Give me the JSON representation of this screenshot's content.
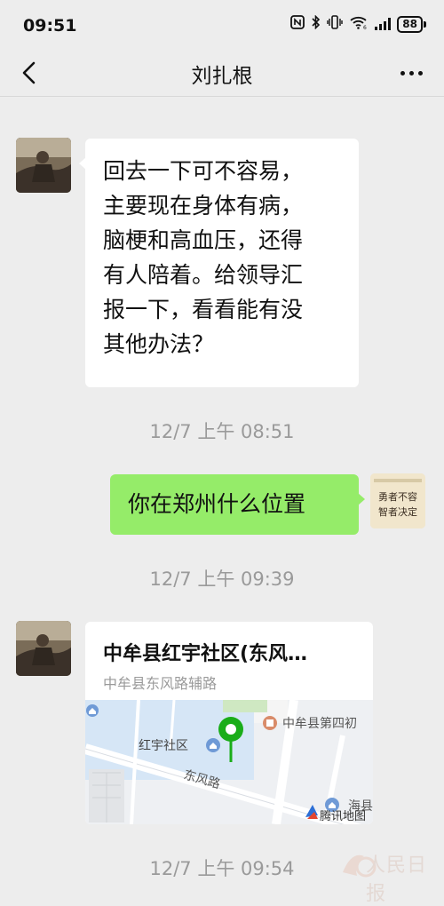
{
  "status_bar": {
    "time": "09:51",
    "battery": "88",
    "icons": [
      "nfc-icon",
      "bluetooth-icon",
      "vibrate-icon",
      "wifi-icon",
      "signal-icon",
      "battery-icon"
    ]
  },
  "nav": {
    "title": "刘扎根",
    "back_icon": "chevron-left-icon",
    "more_icon": "more-dots-icon"
  },
  "messages": [
    {
      "side": "left",
      "type": "text",
      "lines": [
        "回去一下可不容易，",
        "主要现在身体有病，",
        "脑梗和高血压，还得",
        "有人陪着。给领导汇",
        "报一下，看看能有没",
        "其他办法？"
      ]
    },
    {
      "type": "timestamp",
      "text": "12/7 上午 08:51"
    },
    {
      "side": "right",
      "type": "text",
      "lines": [
        "你在郑州什么位置"
      ]
    },
    {
      "type": "timestamp",
      "text": "12/7 上午 09:39"
    },
    {
      "side": "left",
      "type": "location",
      "title": "中牟县红宇社区(东风…",
      "address": "中牟县东风路辅路",
      "map_labels": {
        "community": "红宇社区",
        "road": "东风路",
        "school": "中牟县第四初",
        "partial": "海县",
        "provider": "腾讯地图"
      }
    },
    {
      "type": "timestamp",
      "text": "12/7 上午 09:54"
    }
  ],
  "avatar_right_text": "勇者不容 智者决定",
  "watermark": "人民日报",
  "colors": {
    "background": "#ededed",
    "bubble_white": "#ffffff",
    "bubble_green": "#95ec69",
    "pin": "#1aad19"
  }
}
